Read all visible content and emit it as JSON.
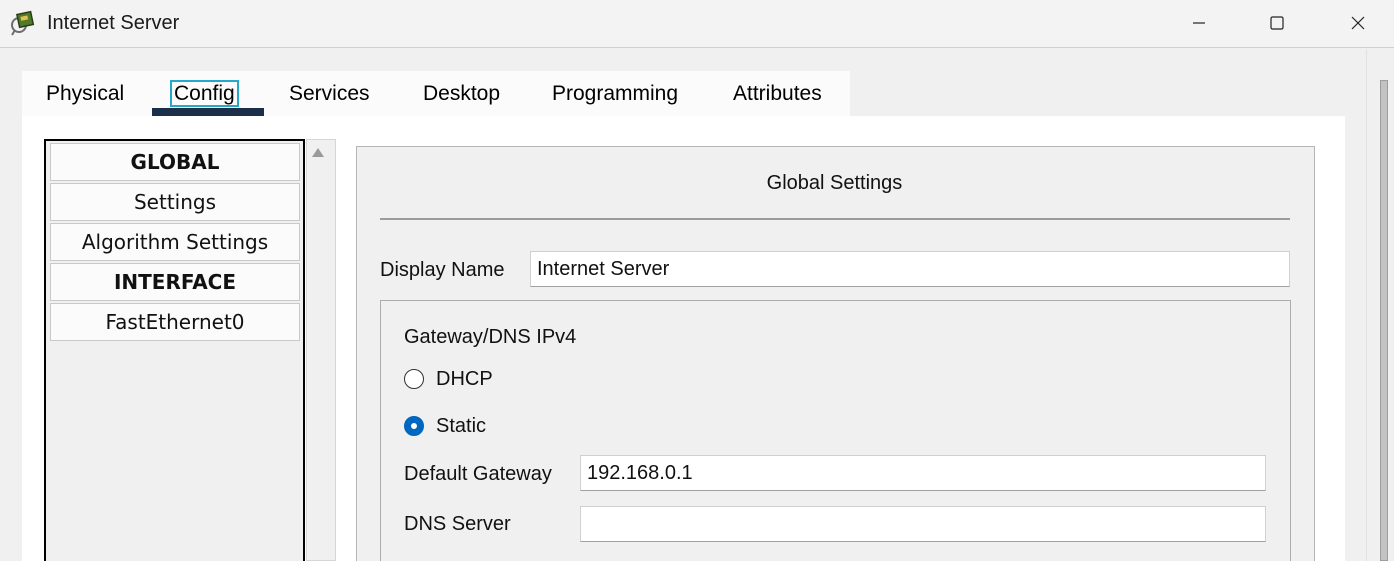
{
  "window": {
    "title": "Internet Server",
    "icon": "server-app-icon"
  },
  "tabs": [
    {
      "label": "Physical",
      "active": false
    },
    {
      "label": "Config",
      "active": true
    },
    {
      "label": "Services",
      "active": false
    },
    {
      "label": "Desktop",
      "active": false
    },
    {
      "label": "Programming",
      "active": false
    },
    {
      "label": "Attributes",
      "active": false
    }
  ],
  "sidebar": {
    "items": [
      {
        "label": "GLOBAL",
        "type": "header"
      },
      {
        "label": "Settings",
        "type": "item"
      },
      {
        "label": "Algorithm Settings",
        "type": "item"
      },
      {
        "label": "INTERFACE",
        "type": "header"
      },
      {
        "label": "FastEthernet0",
        "type": "item"
      }
    ]
  },
  "settings": {
    "title": "Global Settings",
    "display_name_label": "Display Name",
    "display_name_value": "Internet Server",
    "gateway_group_label": "Gateway/DNS IPv4",
    "dhcp_label": "DHCP",
    "static_label": "Static",
    "selected_mode": "Static",
    "default_gateway_label": "Default Gateway",
    "default_gateway_value": "192.168.0.1",
    "dns_server_label": "DNS Server",
    "dns_server_value": ""
  },
  "colors": {
    "active_tab_underline": "#1b2e4a",
    "focus_outline": "#26a8c9",
    "radio_selected": "#0067c0"
  }
}
